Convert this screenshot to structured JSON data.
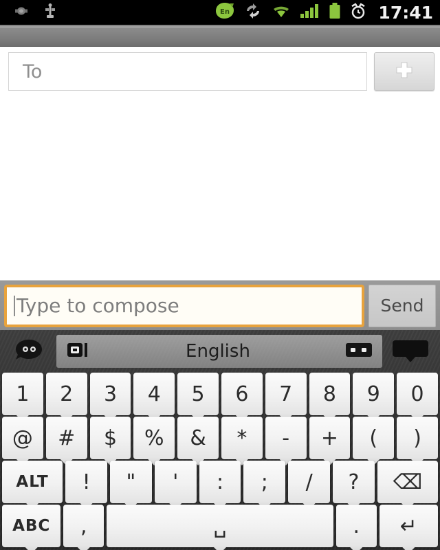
{
  "status_bar": {
    "icons_left": [
      {
        "name": "debug-icon",
        "label": "debug"
      },
      {
        "name": "usb-icon",
        "label": "usb"
      }
    ],
    "icons_right": [
      {
        "name": "language-en-icon",
        "label": "En"
      },
      {
        "name": "sync-icon",
        "label": "sync"
      },
      {
        "name": "wifi-icon",
        "label": "wifi"
      },
      {
        "name": "signal-icon",
        "label": "signal"
      },
      {
        "name": "battery-icon",
        "label": "battery"
      },
      {
        "name": "alarm-icon",
        "label": "alarm"
      }
    ],
    "clock": "17:41",
    "colors": {
      "background": "#000000",
      "accent_green": "#8cc63e",
      "text": "#f2f2f2"
    }
  },
  "recipient": {
    "placeholder": "To",
    "value": "",
    "add_button_label": "+"
  },
  "compose": {
    "placeholder": "Type to compose",
    "value": "",
    "send_label": "Send",
    "focus_border_color": "#e8a33d"
  },
  "keyboard": {
    "toolbar": {
      "emoji_key": "emoji",
      "mic_key": "voice-input",
      "language_label": "English",
      "layout_key": "keyboard-layout",
      "right_key": "keyboard-hide"
    },
    "rows": [
      {
        "name": "number-row",
        "keys": [
          {
            "label": "1",
            "name": "key-1"
          },
          {
            "label": "2",
            "name": "key-2"
          },
          {
            "label": "3",
            "name": "key-3"
          },
          {
            "label": "4",
            "name": "key-4"
          },
          {
            "label": "5",
            "name": "key-5"
          },
          {
            "label": "6",
            "name": "key-6"
          },
          {
            "label": "7",
            "name": "key-7"
          },
          {
            "label": "8",
            "name": "key-8"
          },
          {
            "label": "9",
            "name": "key-9"
          },
          {
            "label": "0",
            "name": "key-0"
          }
        ]
      },
      {
        "name": "symbol-row",
        "keys": [
          {
            "label": "@",
            "name": "key-at"
          },
          {
            "label": "#",
            "name": "key-hash"
          },
          {
            "label": "$",
            "name": "key-dollar"
          },
          {
            "label": "%",
            "name": "key-percent"
          },
          {
            "label": "&",
            "name": "key-ampersand"
          },
          {
            "label": "*",
            "name": "key-asterisk"
          },
          {
            "label": "-",
            "name": "key-hyphen"
          },
          {
            "label": "+",
            "name": "key-plus"
          },
          {
            "label": "(",
            "name": "key-paren-open"
          },
          {
            "label": ")",
            "name": "key-paren-close"
          }
        ]
      },
      {
        "name": "punctuation-row",
        "keys": [
          {
            "label": "ALT",
            "name": "key-alt",
            "style": "alt-key small-text"
          },
          {
            "label": "!",
            "name": "key-exclamation"
          },
          {
            "label": "\"",
            "name": "key-quote-double"
          },
          {
            "label": "'",
            "name": "key-quote-single"
          },
          {
            "label": ":",
            "name": "key-colon"
          },
          {
            "label": ";",
            "name": "key-semicolon"
          },
          {
            "label": "/",
            "name": "key-slash"
          },
          {
            "label": "?",
            "name": "key-question"
          },
          {
            "label": "⌫",
            "name": "key-backspace",
            "style": "back-key"
          }
        ]
      },
      {
        "name": "bottom-row",
        "keys": [
          {
            "label": "ABC",
            "name": "key-abc",
            "style": "abc-key small-text"
          },
          {
            "label": ",",
            "name": "key-comma",
            "style": "comma-key"
          },
          {
            "label": "␣",
            "name": "key-space",
            "style": "space-key"
          },
          {
            "label": ".",
            "name": "key-period",
            "style": "period-key"
          },
          {
            "label": "↵",
            "name": "key-enter",
            "style": "enter-key"
          }
        ]
      }
    ]
  }
}
